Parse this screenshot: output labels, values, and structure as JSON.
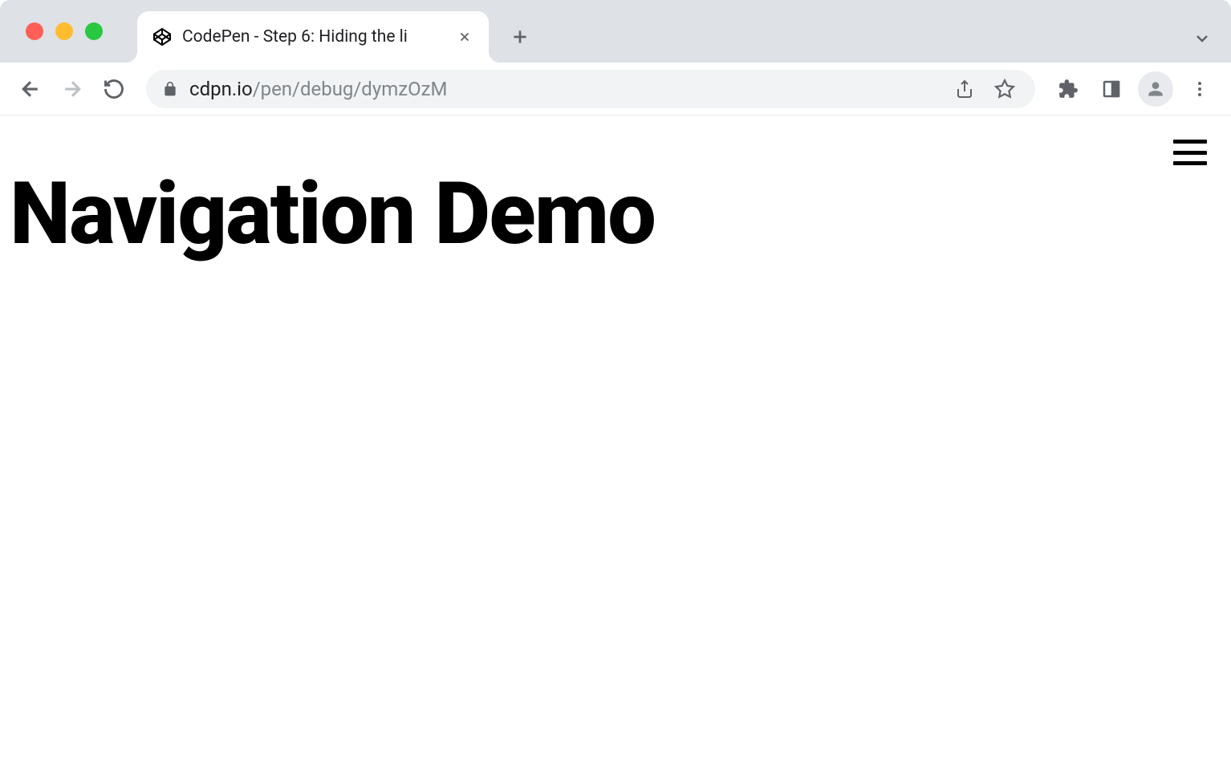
{
  "browser": {
    "tab": {
      "title": "CodePen - Step 6: Hiding the li",
      "favicon": "codepen-icon"
    },
    "url": {
      "domain": "cdpn.io",
      "path": "/pen/debug/dymzOzM"
    }
  },
  "page": {
    "heading": "Navigation Demo"
  }
}
